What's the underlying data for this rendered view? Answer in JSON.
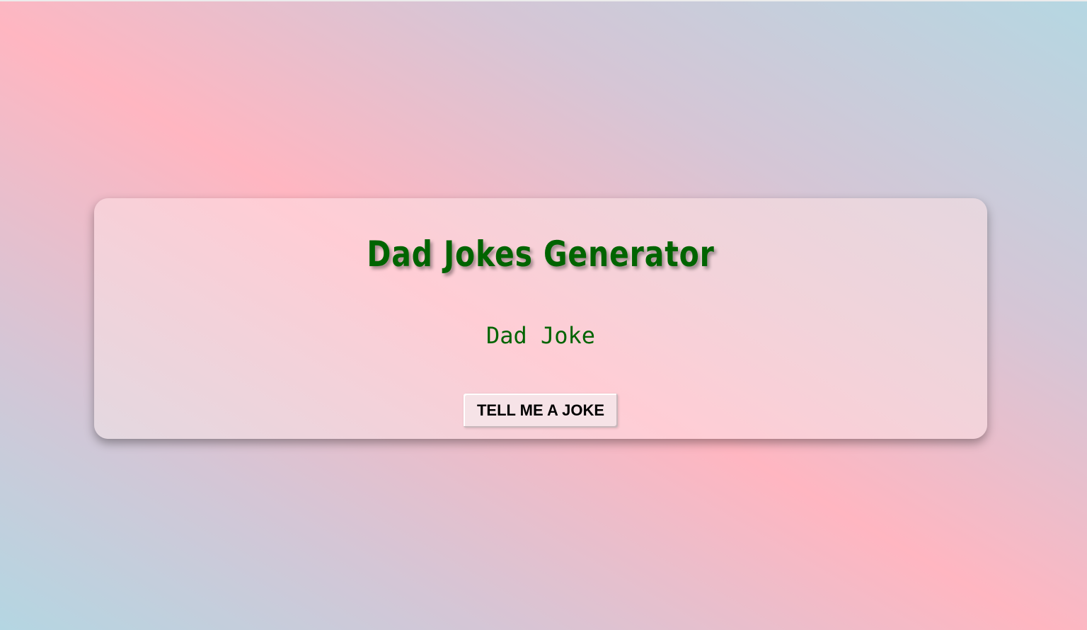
{
  "card": {
    "title": "Dad Jokes Generator",
    "joke_text": "Dad Joke",
    "button_label": "TELL ME A JOKE"
  },
  "colors": {
    "title_color": "#006400",
    "joke_color": "#006400",
    "background_pink": "#ffb6c1",
    "background_blue": "#b4d6e2"
  }
}
